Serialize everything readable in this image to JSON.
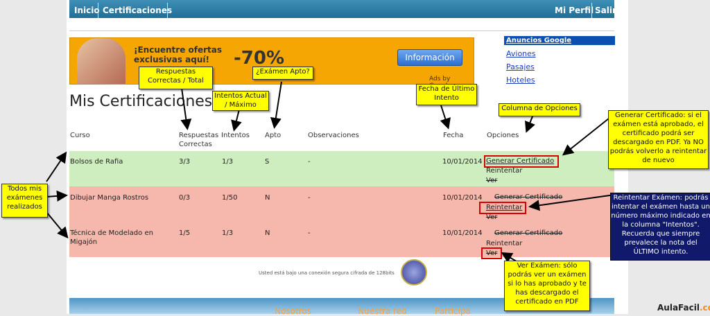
{
  "nav": {
    "home": "Inicio",
    "certs": "Certificaciones",
    "profile": "Mi Perfil",
    "logout": "Salir"
  },
  "banner": {
    "headline": "¡Encuentre ofertas exclusivas aquí!",
    "discount": "-70%",
    "button": "Información",
    "ads_by": "Ads by Google"
  },
  "ads": {
    "header": "Anuncios Google",
    "links": [
      "Aviones",
      "Pasajes",
      "Hoteles"
    ]
  },
  "page_title": "Mis Certificaciones",
  "columns": {
    "course": "Curso",
    "correct": "Respuestas Correctas",
    "attempts": "Intentos",
    "passed": "Apto",
    "notes": "Observaciones",
    "date": "Fecha",
    "options": "Opciones"
  },
  "rows": [
    {
      "course": "Bolsos de Rafia",
      "correct": "3/3",
      "attempts": "1/3",
      "passed": "S",
      "notes": "-",
      "date": "10/01/2014",
      "opt1": "Generar Certificado",
      "opt2": "Reintentar",
      "opt3": "Ver"
    },
    {
      "course": "Dibujar Manga Rostros",
      "correct": "0/3",
      "attempts": "1/50",
      "passed": "N",
      "notes": "-",
      "date": "10/01/2014",
      "opt1": "Generar Certificado",
      "opt2": "Reintentar",
      "opt3": "Ver"
    },
    {
      "course": "Técnica de Modelado en Migajón",
      "correct": "1/5",
      "attempts": "1/3",
      "passed": "N",
      "notes": "-",
      "date": "10/01/2014",
      "opt1": "Generar Certificado",
      "opt2": "Reintentar",
      "opt3": "Ver"
    }
  ],
  "secure_text": "Usted está bajo una conexión segura cifrada de 128bits",
  "footer": {
    "links": [
      "Nosotros",
      "Nuestra red",
      "Participa"
    ]
  },
  "brand": {
    "name": "AulaFacil",
    "tld": ".com"
  },
  "notes": {
    "correct_total": "Respuestas Correctas / Total",
    "attempts": "Intentos Actual / Máximo",
    "passed": "¿Exámen Apto?",
    "last_date": "Fecha de Último Intento",
    "options_col": "Columna de Opciones",
    "all_exams": "Todos mis exámenes realizados",
    "generate": "Generar Certificado: si el exámen está aprobado, el certificado podrá ser descargado en PDF. Ya NO podrás volverlo a reintentar de nuevo",
    "retry": "Reintentar Exámen: podrás intentar el exámen hasta un número máximo indicado en la columna \"Intentos\". Recuerda que siempre prevalece la nota del ÚLTIMO intento.",
    "view": "Ver Exámen: sólo podrás ver un exámen si lo has aprobado y te has descargado el certificado en PDF"
  },
  "colors": {
    "nav": "#1f6e98",
    "pass_row": "#cfeec0",
    "fail_row": "#f6b8ac",
    "note": "#ffff00",
    "navy_note": "#11196b",
    "highlight": "#d40000"
  }
}
